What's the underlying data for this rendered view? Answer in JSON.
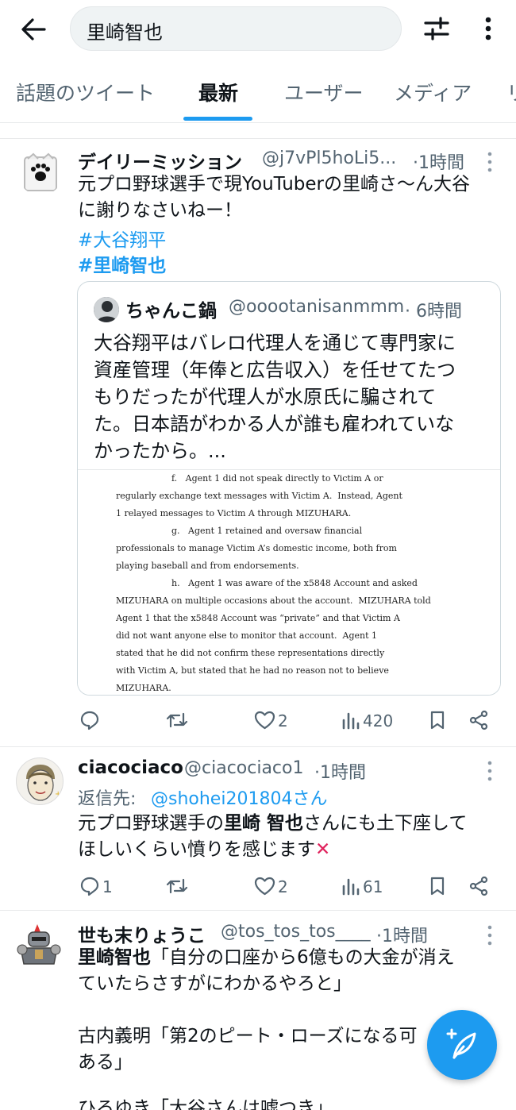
{
  "search": {
    "query": "里崎智也"
  },
  "tabs": [
    "話題のツイート",
    "最新",
    "ユーザー",
    "メディア",
    "リ"
  ],
  "tweets": [
    {
      "name": "デイリーミッション",
      "handle": "@j7vPl5hoLi5...",
      "time": "·1時間",
      "lines": [
        "元プロ野球選手で現YouTuberの里崎さ〜ん大谷",
        "に謝りなさいねー！"
      ],
      "hashtags": [
        "#大谷翔平",
        "#里崎智也"
      ],
      "quote": {
        "name": "ちゃんこ鍋",
        "handle": "@ooootanisanmmm",
        "time": "· 6時間",
        "lines": [
          "大谷翔平はバレロ代理人を通じて専門家に",
          "資産管理（年俸と広告収入）を任せてたつ",
          "もりだったが代理人が水原氏に騙されて",
          "た。日本語がわかる人が誰も雇われていな",
          "かったから。..."
        ],
        "doc_lines": [
          "f.   Agent 1 did not speak directly to Victim A or",
          "regularly exchange text messages with Victim A.  Instead, Agent",
          "1 relayed messages to Victim A through MIZUHARA.",
          "g.   Agent 1 retained and oversaw financial",
          "professionals to manage Victim A’s domestic income, both from",
          "playing baseball and from endorsements.",
          "h.   Agent 1 was aware of the x5848 Account and asked",
          "MIZUHARA on multiple occasions about the account.  MIZUHARA told",
          "Agent 1 that the x5848 Account was “private” and that Victim A",
          "did not want anyone else to monitor that account.  Agent 1",
          "stated that he did not confirm these representations directly",
          "with Victim A, but stated that he had no reason not to believe",
          "MIZUHARA."
        ]
      },
      "actions": {
        "replies": "",
        "retweets": "",
        "likes": "2",
        "views": "420"
      }
    },
    {
      "name": "ciacociaco",
      "handle": "@ciacociaco1",
      "time": "·1時間",
      "reply_prefix": "返信先:",
      "reply_to": "@shohei201804さん",
      "line1_a": "元プロ野球選手の",
      "line1_b": "里崎 智也",
      "line1_c": "さんにも土下座して",
      "line2": "ほしいくらい憤りを感じます",
      "line2_emoji": "✕",
      "actions": {
        "replies": "1",
        "retweets": "",
        "likes": "2",
        "views": "61"
      }
    },
    {
      "name": "世も末りょうこ",
      "handle": "@tos_tos_tos____",
      "time": "·1時間",
      "line1_a": "里崎智也",
      "line1_b": "「自分の口座から6億もの大金が消え",
      "line2": "ていたらさすがにわかるやろと」",
      "line3": "古内義明「第2のピート・ローズになる可",
      "line4": "ある」",
      "line5": "ひろゆき「大谷さんは嘘つき」"
    }
  ],
  "icons": [
    "back-arrow-icon",
    "filter-sliders-icon",
    "more-vertical-icon",
    "reply-icon",
    "retweet-icon",
    "like-icon",
    "views-icon",
    "bookmark-icon",
    "share-icon",
    "compose-feather-icon"
  ],
  "colors": {
    "accent": "#1d9bf0",
    "secondary_text": "#536471",
    "divider": "#e7e9ea"
  }
}
